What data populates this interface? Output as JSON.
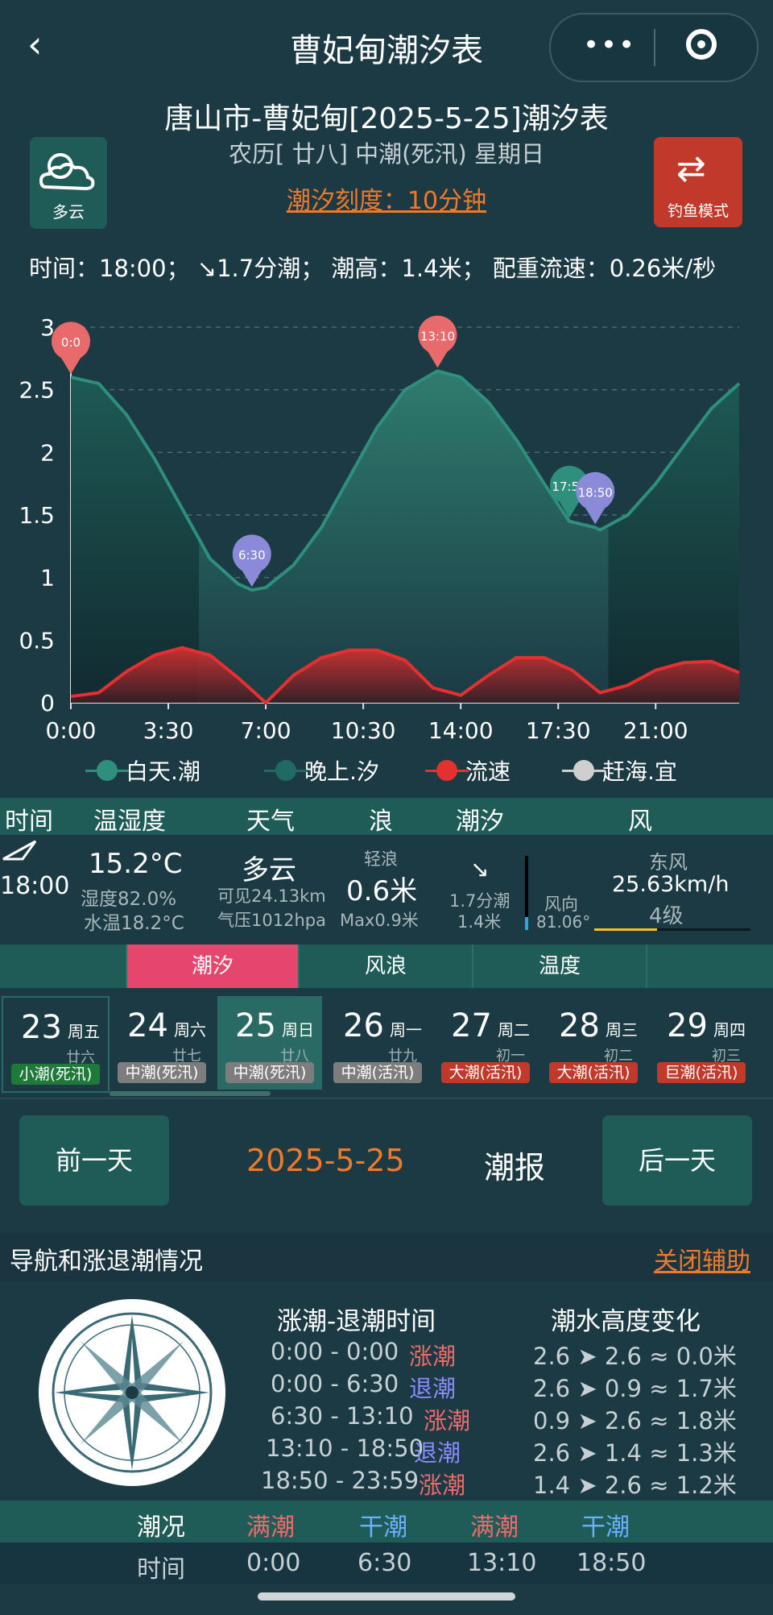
{
  "header": {
    "title": "曹妃甸潮汐表"
  },
  "subtitle": "唐山市-曹妃甸[2025-5-25]潮汐表",
  "lunar_line": "农历[ 廿八] 中潮(死汛) 星期日",
  "scale_text": "潮汐刻度：10分钟",
  "weather_button": {
    "label": "多云",
    "icon": "cloudy-icon"
  },
  "fishing_button": {
    "label": "钓鱼模式",
    "icon": "repeat-icon"
  },
  "info_line": "时间：18:00；  ↘1.7分潮；  潮高：1.4米；  配重流速：0.26米/秒",
  "legend": [
    {
      "label": "白天.潮",
      "color": "#2e8f7c"
    },
    {
      "label": "晚上.汐",
      "color": "#1f6b63"
    },
    {
      "label": "流速",
      "color": "#e53030"
    },
    {
      "label": "赶海.宜",
      "color": "#cfcfcf"
    }
  ],
  "chart_data": {
    "type": "area",
    "x_ticks": [
      "0:00",
      "3:30",
      "7:00",
      "10:30",
      "14:00",
      "17:30",
      "21:00"
    ],
    "y_ticks": [
      "0",
      "0.5",
      "1",
      "1.5",
      "2",
      "2.5",
      "3"
    ],
    "ylim": [
      0,
      3
    ],
    "xlim_hours": [
      0,
      24
    ],
    "series": [
      {
        "name": "潮高",
        "x": [
          0,
          1,
          2,
          3,
          4,
          5,
          6,
          6.5,
          7,
          8,
          9,
          10,
          11,
          12,
          13,
          13.17,
          14,
          15,
          16,
          17,
          17.9,
          18.83,
          19,
          20,
          21,
          22,
          23,
          24
        ],
        "values": [
          2.6,
          2.55,
          2.3,
          1.95,
          1.55,
          1.15,
          0.95,
          0.9,
          0.92,
          1.1,
          1.4,
          1.8,
          2.2,
          2.5,
          2.63,
          2.65,
          2.6,
          2.4,
          2.1,
          1.75,
          1.45,
          1.4,
          1.38,
          1.5,
          1.75,
          2.05,
          2.35,
          2.55
        ]
      },
      {
        "name": "流速",
        "x": [
          0,
          1,
          2,
          3,
          4,
          5,
          6,
          7,
          8,
          9,
          10,
          11,
          12,
          13,
          14,
          15,
          16,
          17,
          18,
          19,
          20,
          21,
          22,
          23,
          24
        ],
        "values": [
          0.05,
          0.08,
          0.25,
          0.38,
          0.44,
          0.38,
          0.2,
          0.0,
          0.22,
          0.36,
          0.42,
          0.42,
          0.34,
          0.12,
          0.06,
          0.22,
          0.36,
          0.36,
          0.26,
          0.08,
          0.14,
          0.26,
          0.32,
          0.33,
          0.24
        ]
      }
    ],
    "night_ranges_hours": [
      [
        0,
        4.6
      ],
      [
        19.3,
        24
      ]
    ],
    "markers": [
      {
        "label": "0:0",
        "x": 0,
        "y": 2.6,
        "color": "#e86a6a"
      },
      {
        "label": "6:30",
        "x": 6.5,
        "y": 0.9,
        "color": "#8a8ad8"
      },
      {
        "label": "13:10",
        "x": 13.17,
        "y": 2.65,
        "color": "#e86a6a"
      },
      {
        "label": "17:54",
        "x": 17.9,
        "y": 1.45,
        "color": "#2e8f7c"
      },
      {
        "label": "18:50",
        "x": 18.83,
        "y": 1.4,
        "color": "#8a8ad8"
      }
    ],
    "grid": "horizontal-dashed"
  },
  "table_headers": [
    "时间",
    "温湿度",
    "天气",
    "浪",
    "潮汐",
    "风"
  ],
  "table_row": {
    "time": "18:00",
    "temp": "15.2°C",
    "humidity": "湿度82.0%",
    "water_temp": "水温18.2°C",
    "weather": "多云",
    "visibility": "可见24.13km",
    "pressure": "气压1012hpa",
    "wave_label": "轻浪",
    "wave": "0.6米",
    "wave_max": "Max0.9米",
    "tide_arrow": "↘",
    "tide_change": "1.7分潮",
    "tide_height": "1.4米",
    "wind_dir_label": "风向",
    "wind_deg": "81.06°",
    "wind_name": "东风",
    "wind_speed": "25.63km/h",
    "wind_level": "4级"
  },
  "tabs": [
    "潮汐",
    "风浪",
    "温度"
  ],
  "days": [
    {
      "num": "23",
      "wk": "周五",
      "lunar": "廿六",
      "badge": "小潮(死汛)",
      "color": "#1f7a3a"
    },
    {
      "num": "24",
      "wk": "周六",
      "lunar": "廿七",
      "badge": "中潮(死汛)",
      "color": "#7d7d7d"
    },
    {
      "num": "25",
      "wk": "周日",
      "lunar": "廿八",
      "badge": "中潮(死汛)",
      "color": "#7d7d7d"
    },
    {
      "num": "26",
      "wk": "周一",
      "lunar": "廿九",
      "badge": "中潮(活汛)",
      "color": "#7d7d7d"
    },
    {
      "num": "27",
      "wk": "周二",
      "lunar": "初一",
      "badge": "大潮(活汛)",
      "color": "#c0392b"
    },
    {
      "num": "28",
      "wk": "周三",
      "lunar": "初二",
      "badge": "大潮(活汛)",
      "color": "#c0392b"
    },
    {
      "num": "29",
      "wk": "周四",
      "lunar": "初三",
      "badge": "巨潮(活汛)",
      "color": "#c0392b"
    }
  ],
  "nav": {
    "prev": "前一天",
    "date": "2025-5-25",
    "report": "潮报",
    "next": "后一天"
  },
  "section": {
    "title": "导航和涨退潮情况",
    "close": "关闭辅助"
  },
  "tide_times_header": "涨潮-退潮时间",
  "height_change_header": "潮水高度变化",
  "tide_rows": [
    {
      "range": "0:00 - 0:00",
      "type": "涨潮",
      "change": "2.6 ➤ 2.6 ≈ 0.0米"
    },
    {
      "range": "0:00 - 6:30",
      "type": "退潮",
      "change": "2.6 ➤ 0.9 ≈ 1.7米"
    },
    {
      "range": "6:30 - 13:10",
      "type": "涨潮",
      "change": "0.9 ➤ 2.6 ≈ 1.8米"
    },
    {
      "range": "13:10 - 18:50",
      "type": "退潮",
      "change": "2.6 ➤ 1.4 ≈ 1.3米"
    },
    {
      "range": "18:50 - 23:59",
      "type": "涨潮",
      "change": "1.4 ➤ 2.6 ≈ 1.2米"
    }
  ],
  "bottom_table": {
    "row1": [
      "潮况",
      "满潮",
      "干潮",
      "满潮",
      "干潮"
    ],
    "row2": [
      "时间",
      "0:00",
      "6:30",
      "13:10",
      "18:50"
    ]
  }
}
